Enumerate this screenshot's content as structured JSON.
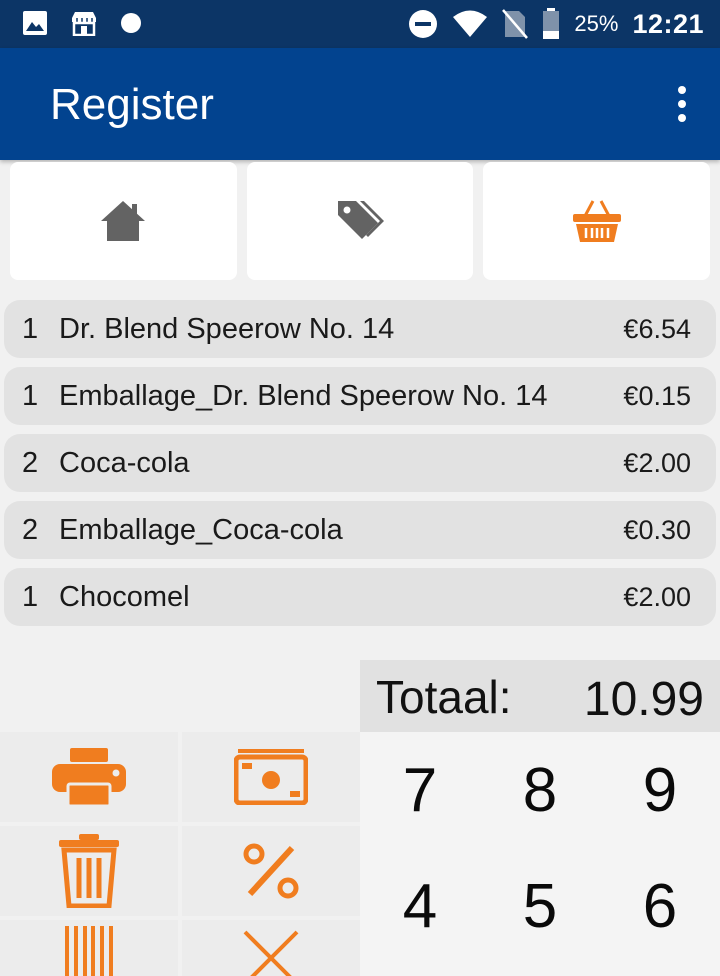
{
  "status_bar": {
    "left_icons": [
      "image-icon",
      "store-icon",
      "dot-icon"
    ],
    "right_icons": [
      "do-not-disturb-icon",
      "wifi-icon",
      "no-sim-icon",
      "battery-icon"
    ],
    "battery": "25%",
    "time": "12:21"
  },
  "app_bar": {
    "title": "Register",
    "overflow_icon": "more-vert-icon"
  },
  "tabs": [
    {
      "name": "home",
      "icon": "home-icon",
      "color": "#636363"
    },
    {
      "name": "tags",
      "icon": "tag-icon",
      "color": "#636363"
    },
    {
      "name": "basket",
      "icon": "basket-icon",
      "color": "#f07d1f",
      "selected": true
    }
  ],
  "order": {
    "items": [
      {
        "qty": "1",
        "name": "Dr. Blend Speerow No. 14",
        "price": "€6.54"
      },
      {
        "qty": "1",
        "name": "Emballage_Dr. Blend Speerow No. 14",
        "price": "€0.15"
      },
      {
        "qty": "2",
        "name": "Coca-cola",
        "price": "€2.00"
      },
      {
        "qty": "2",
        "name": "Emballage_Coca-cola",
        "price": "€0.30"
      },
      {
        "qty": "1",
        "name": "Chocomel",
        "price": "€2.00"
      }
    ],
    "total_label": "Totaal:",
    "total_value": "10.99"
  },
  "actions": [
    {
      "icon": "printer-icon"
    },
    {
      "icon": "cash-icon"
    },
    {
      "icon": "trash-icon"
    },
    {
      "icon": "percent-icon"
    },
    {
      "icon": "barcode-icon"
    },
    {
      "icon": "close-icon"
    }
  ],
  "numpad": {
    "keys": [
      "7",
      "8",
      "9",
      "4",
      "5",
      "6"
    ]
  },
  "colors": {
    "status_bar": "#0c3566",
    "app_bar": "#02438f",
    "accent": "#f07d1f",
    "icon_gray": "#636363"
  }
}
